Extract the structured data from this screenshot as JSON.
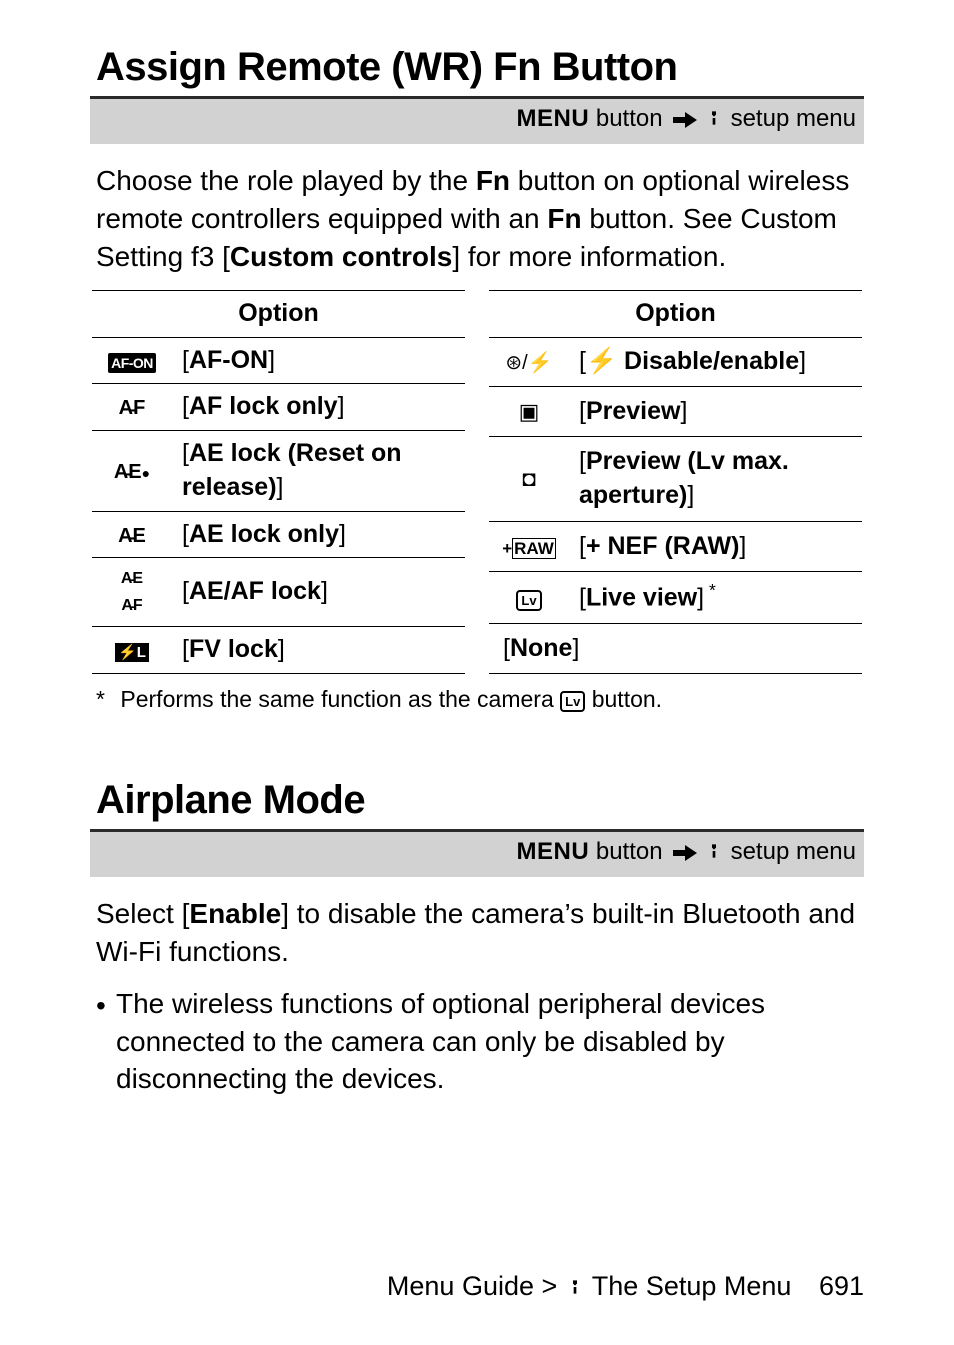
{
  "section1": {
    "title": "Assign Remote (WR) Fn Button",
    "breadcrumb_pre": "MENU",
    "breadcrumb_post1": " button ",
    "breadcrumb_post2": " setup menu",
    "para_pre": "Choose the role played by the ",
    "para_b1": "Fn",
    "para_mid1": " button on optional wireless remote controllers equipped with an ",
    "para_b2": "Fn",
    "para_mid2": " button. See Custom Setting f3 [",
    "para_b3": "Custom controls",
    "para_post": "] for more information."
  },
  "tables": {
    "header": "Option",
    "left": [
      {
        "icon": "af-on-icon",
        "glyph": "AF-ON",
        "label": "[<b>AF-ON</b>]"
      },
      {
        "icon": "af-lock-icon",
        "glyph": "AF🔒",
        "label": "[<b>AF lock only</b>]"
      },
      {
        "icon": "ae-reset-icon",
        "glyph": "AE⟲",
        "label": "[<b>AE lock (Reset on release)</b>]"
      },
      {
        "icon": "ae-lock-icon",
        "glyph": "AE🔒",
        "label": "[<b>AE lock only</b>]"
      },
      {
        "icon": "aeaf-lock-icon",
        "glyph": "AEAF",
        "label": "[<b>AE/AF lock</b>]"
      },
      {
        "icon": "fv-lock-icon",
        "glyph": "⚡L",
        "label": "[<b>FV lock</b>]"
      }
    ],
    "right": [
      {
        "icon": "flash-disable-icon",
        "glyph": "⊘/⚡",
        "label": "[<b>⚡ Disable/enable</b>]"
      },
      {
        "icon": "preview-icon",
        "glyph": "◉",
        "label": "[<b>Preview</b>]"
      },
      {
        "icon": "preview-lv-icon",
        "glyph": "◎",
        "label": "[<b>Preview (Lv max. aperture)</b>]"
      },
      {
        "icon": "plus-raw-icon",
        "glyph": "+RAW",
        "label": "[<b>+ NEF (RAW)</b>]"
      },
      {
        "icon": "live-view-icon",
        "glyph": "Lv",
        "label": "[<b>Live view</b>]<sup class=\"ast\"> *</sup>"
      },
      {
        "span": true,
        "label": "[<b>None</b>]"
      }
    ]
  },
  "footnote": {
    "mark": "*",
    "pre": "Performs the same function as the camera ",
    "post": " button."
  },
  "section2": {
    "title": "Airplane Mode",
    "breadcrumb_pre": "MENU",
    "breadcrumb_post1": " button ",
    "breadcrumb_post2": " setup menu",
    "para_pre": "Select [",
    "para_b": "Enable",
    "para_post": "] to disable the camera’s built-in Bluetooth and Wi-Fi functions.",
    "bullet": "The wireless functions of optional peripheral devices connected to the camera can only be disabled by disconnecting the devices."
  },
  "footer": {
    "pre": "Menu Guide > ",
    "post": " The Setup Menu",
    "page": "691"
  }
}
